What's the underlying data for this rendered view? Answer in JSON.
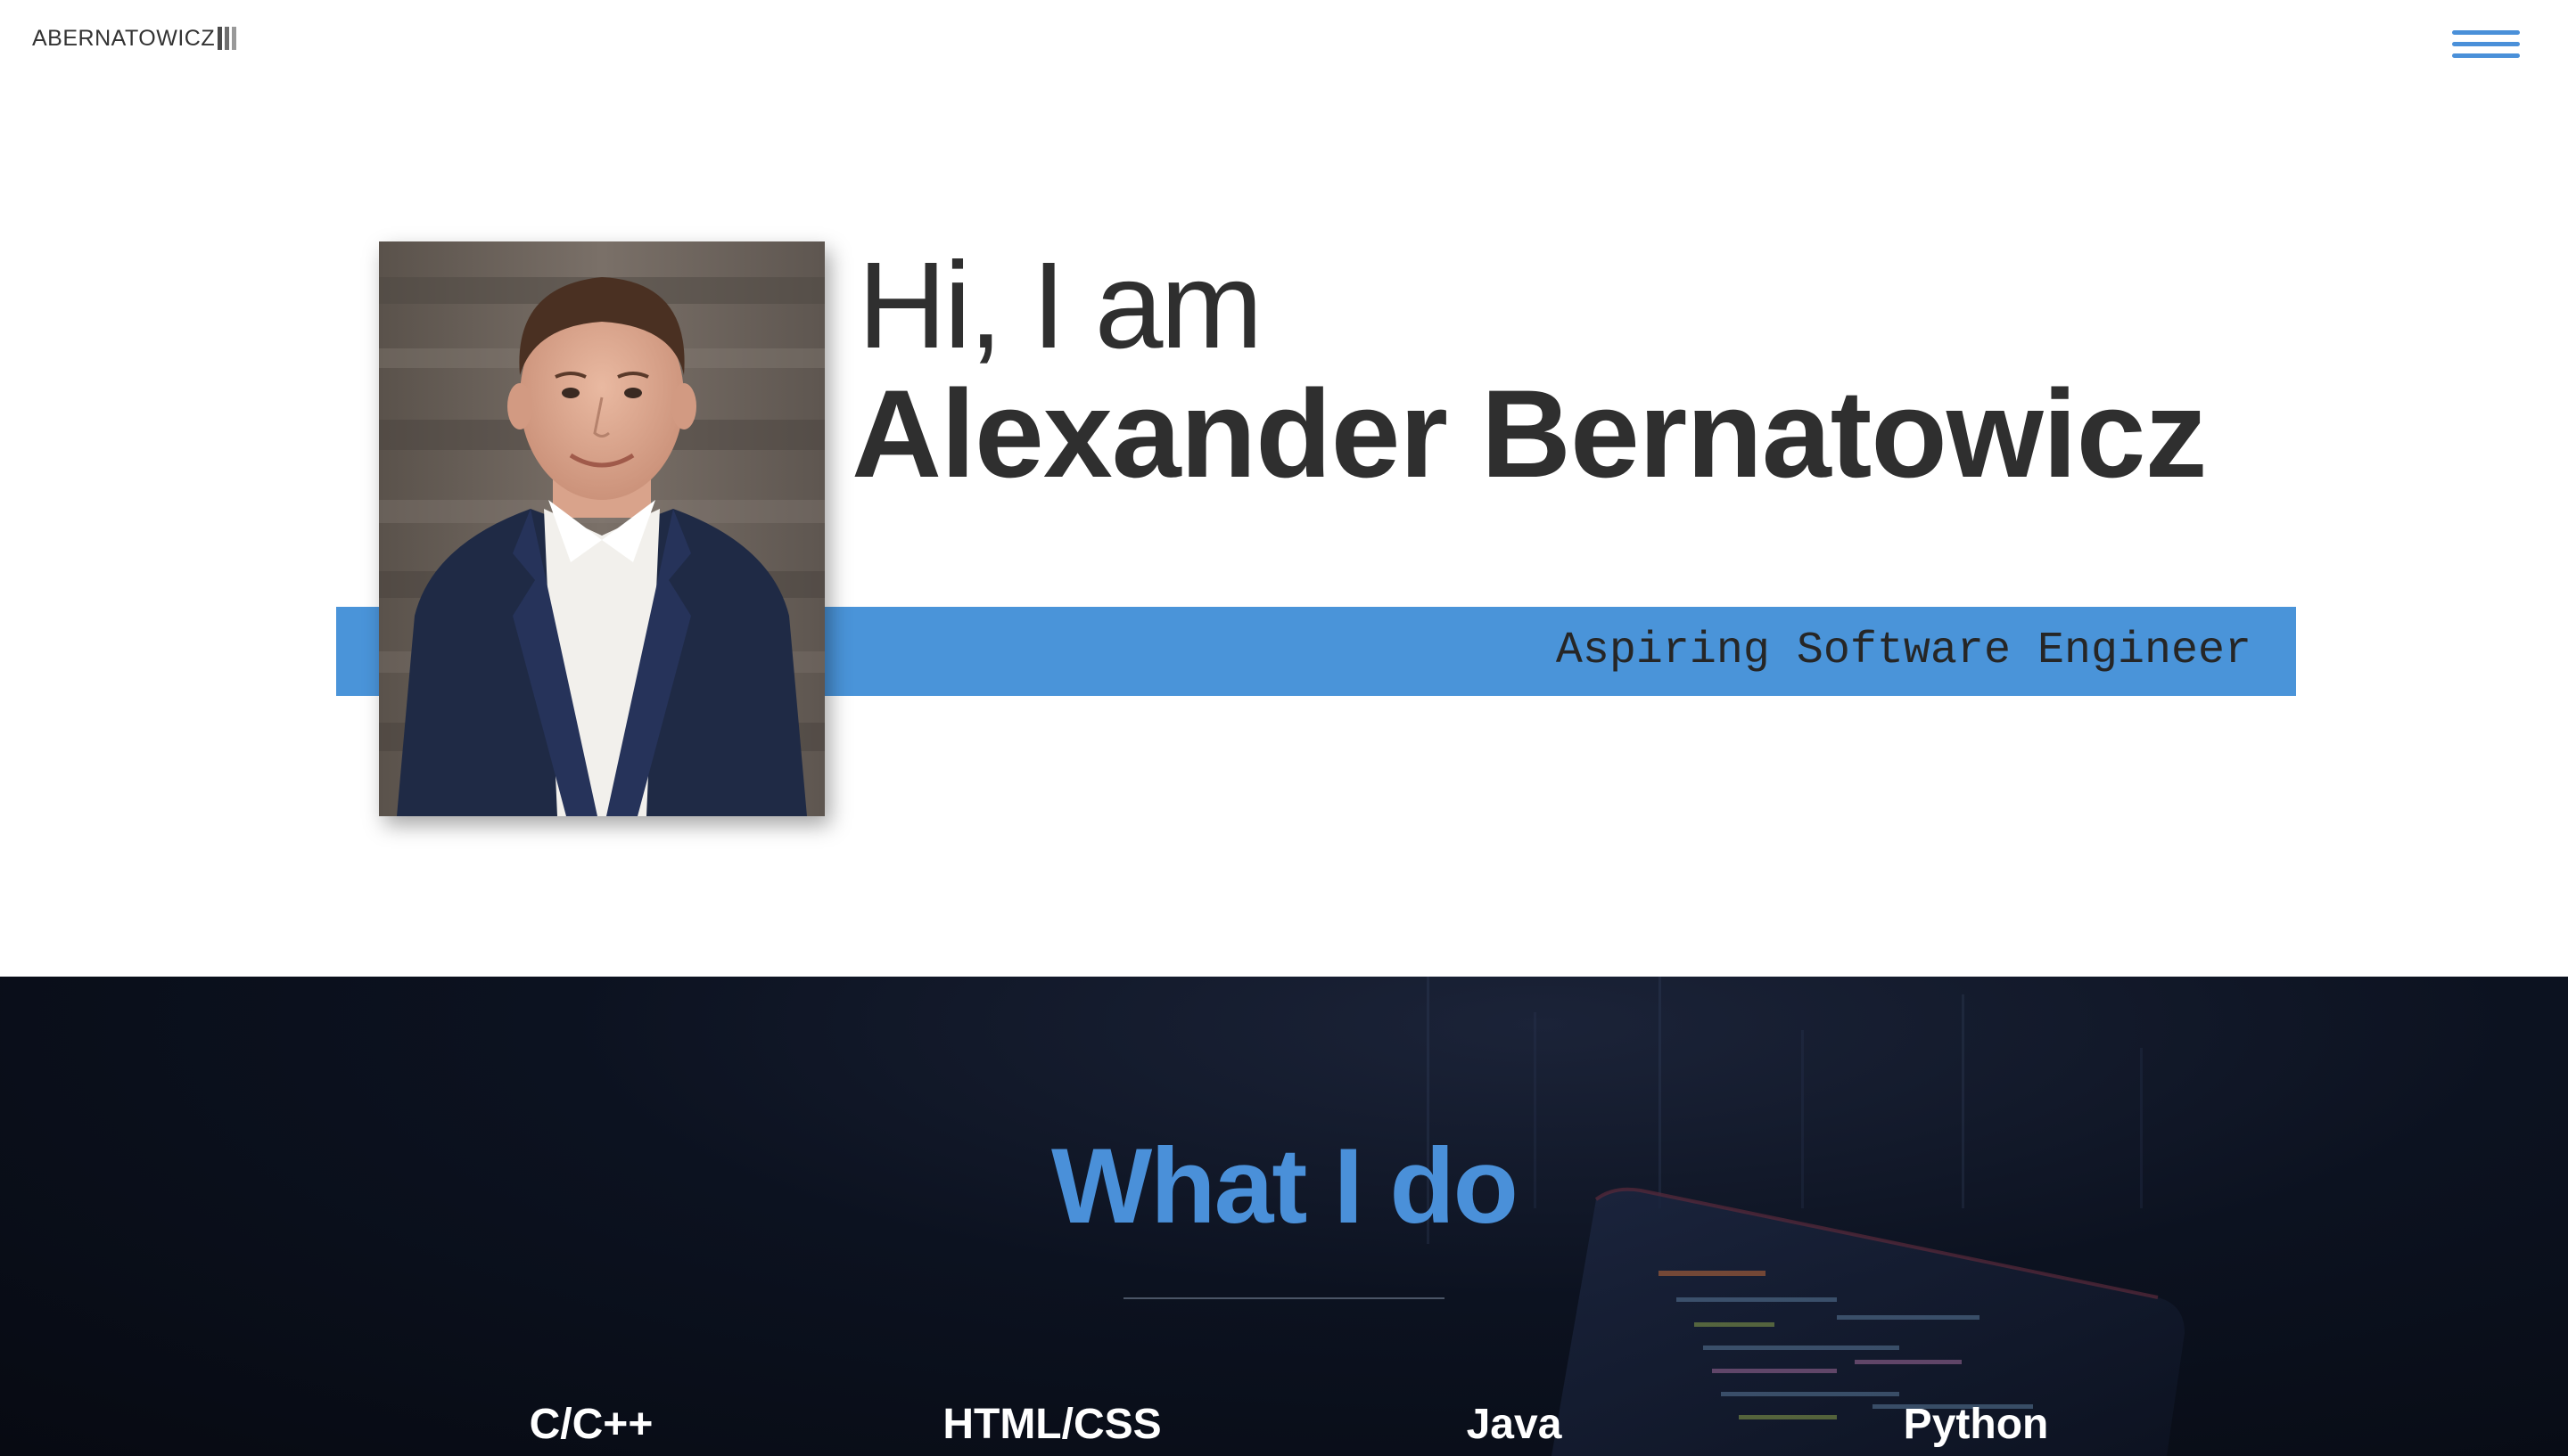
{
  "header": {
    "logo_text": "ABERNATOWICZ",
    "menu_icon": "hamburger-menu-icon",
    "accent_color": "#4a90d9"
  },
  "hero": {
    "greeting": "Hi, I am",
    "name": "Alexander Bernatowicz",
    "tagline": "Aspiring Software Engineer",
    "band_color": "#4a94d9"
  },
  "services": {
    "title": "What I do",
    "title_color": "#4a90d9",
    "skills": [
      "C/C++",
      "HTML/CSS",
      "Java",
      "Python"
    ]
  }
}
